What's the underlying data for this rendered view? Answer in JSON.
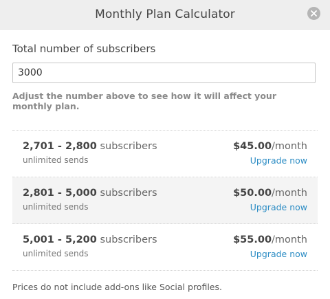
{
  "modal": {
    "title": "Monthly Plan Calculator"
  },
  "form": {
    "label": "Total number of subscribers",
    "value": "3000",
    "help": "Adjust the number above to see how it will affect your monthly plan."
  },
  "plans": [
    {
      "range": "2,701 - 2,800",
      "unit": "subscribers",
      "sub": "unlimited sends",
      "price": "$45.00",
      "per": "/month",
      "action": "Upgrade now"
    },
    {
      "range": "2,801 - 5,000",
      "unit": "subscribers",
      "sub": "unlimited sends",
      "price": "$50.00",
      "per": "/month",
      "action": "Upgrade now"
    },
    {
      "range": "5,001 - 5,200",
      "unit": "subscribers",
      "sub": "unlimited sends",
      "price": "$55.00",
      "per": "/month",
      "action": "Upgrade now"
    }
  ],
  "footnote": "Prices do not include add-ons like Social profiles.",
  "icons": {
    "close": "close-icon"
  },
  "colors": {
    "link": "#2b8cc4",
    "header_bg": "#eeeeee",
    "highlight_bg": "#f4f4f4"
  }
}
